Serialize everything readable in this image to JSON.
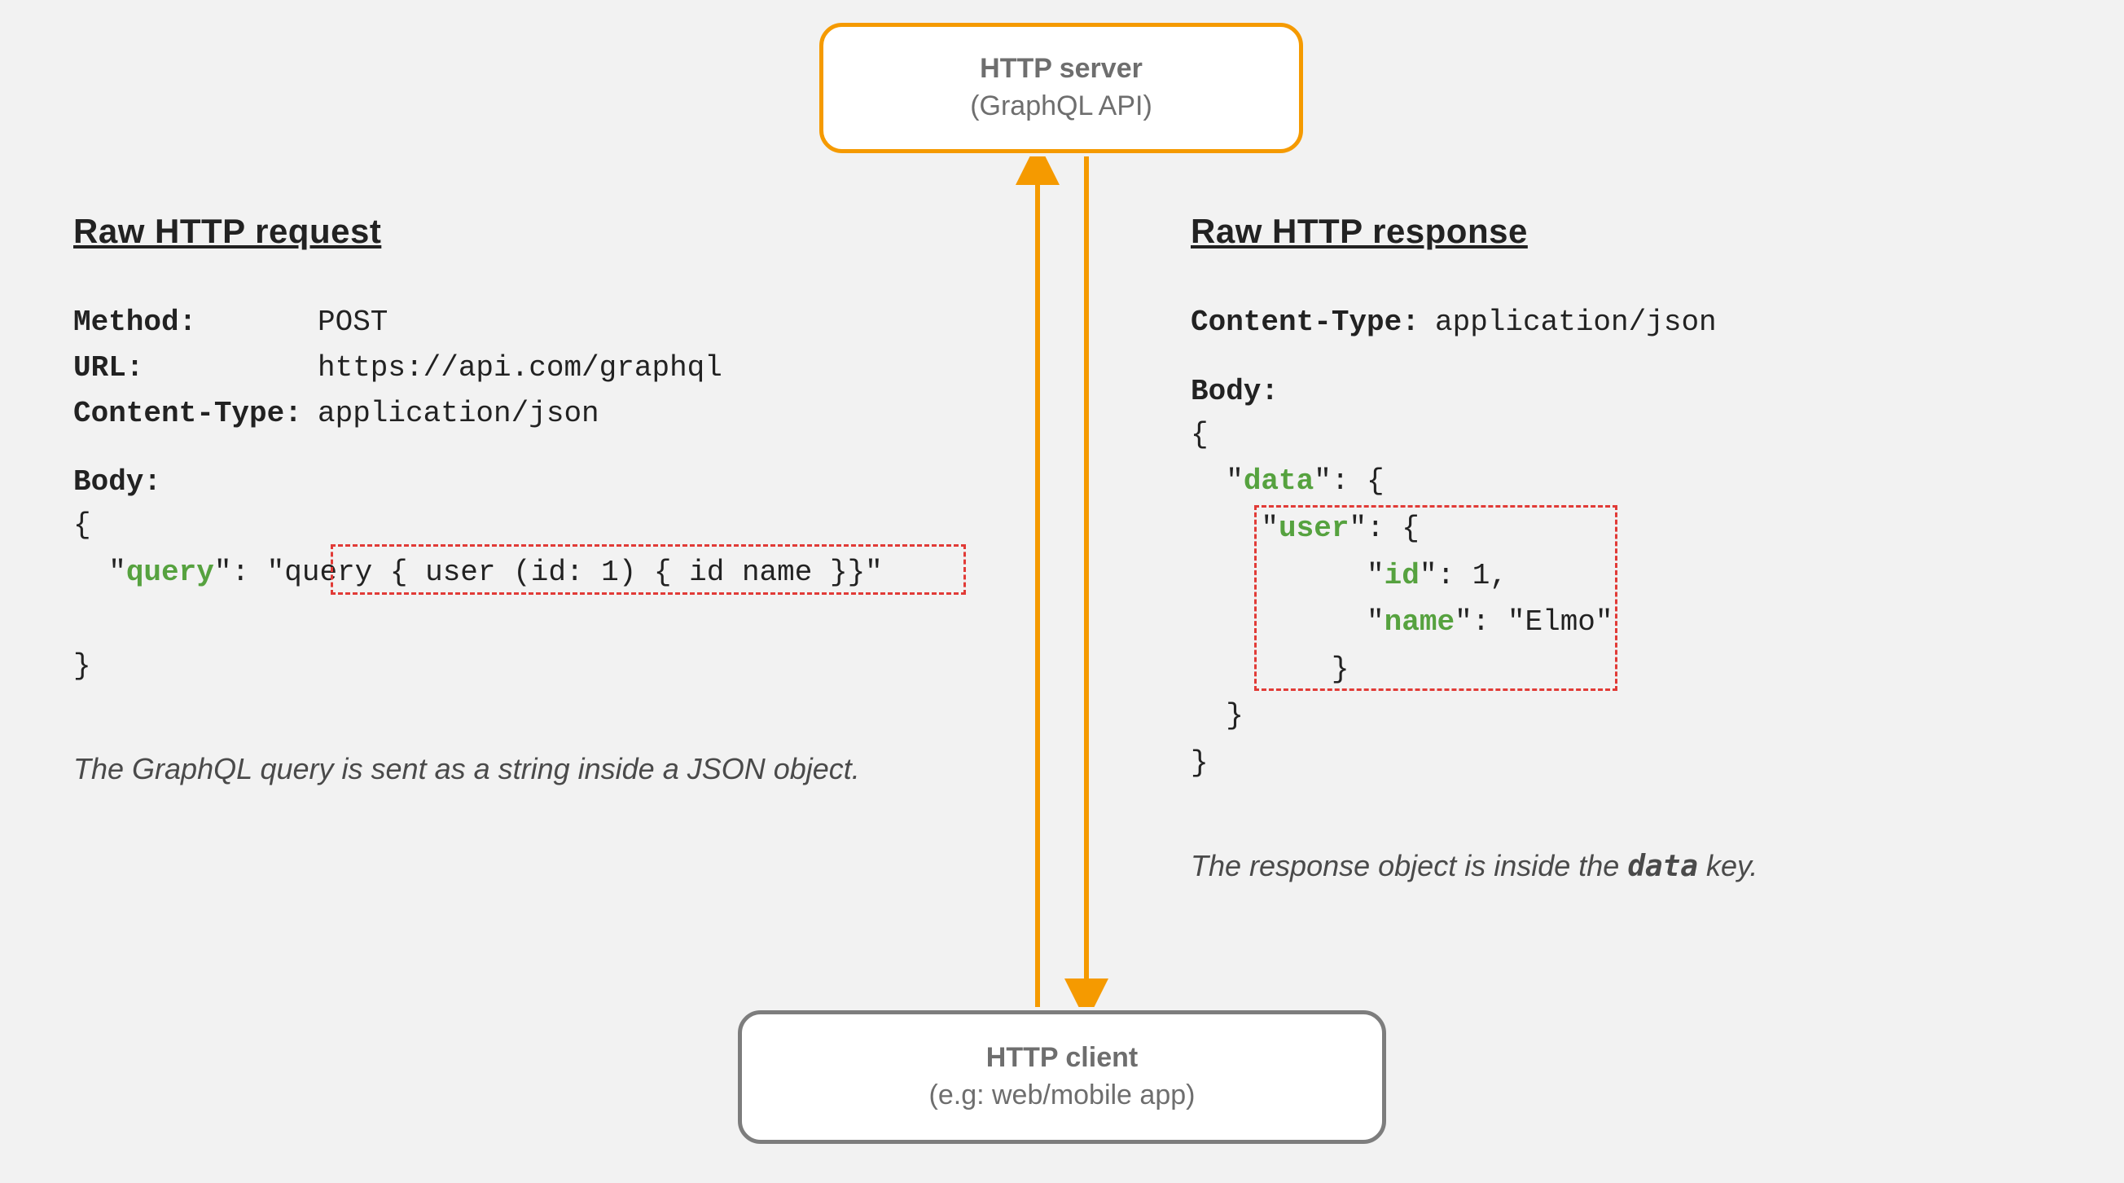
{
  "server": {
    "title": "HTTP server",
    "subtitle": "(GraphQL API)"
  },
  "client": {
    "title": "HTTP client",
    "subtitle": "(e.g: web/mobile app)"
  },
  "request": {
    "title": "Raw HTTP request",
    "method_label": "Method:",
    "method_value": "POST",
    "url_label": "URL:",
    "url_value": "https://api.com/graphql",
    "ctype_label": "Content-Type:",
    "ctype_value": "application/json",
    "body_label": "Body:",
    "body_open": "{",
    "body_key": "query",
    "body_query_value": "\"query { user (id: 1) { id name }}\"",
    "body_close": "}",
    "caption": "The GraphQL query is sent as a string inside a JSON object."
  },
  "response": {
    "title": "Raw HTTP response",
    "ctype_label": "Content-Type:",
    "ctype_value": "application/json",
    "body_label": "Body:",
    "b_open": "{",
    "b_data_key": "data",
    "b_user_key": "user",
    "b_id_key": "id",
    "b_id_val": "1,",
    "b_name_key": "name",
    "b_name_val": "\"Elmo\"",
    "b_user_close": "}",
    "b_data_close": "}",
    "b_close": "}",
    "caption_before": "The response object is inside the ",
    "caption_code": "data",
    "caption_after": " key."
  },
  "colors": {
    "accent_orange": "#f59a00",
    "accent_red": "#e13b37",
    "code_green": "#56a23f",
    "node_border_grey": "#7d7d7d"
  }
}
